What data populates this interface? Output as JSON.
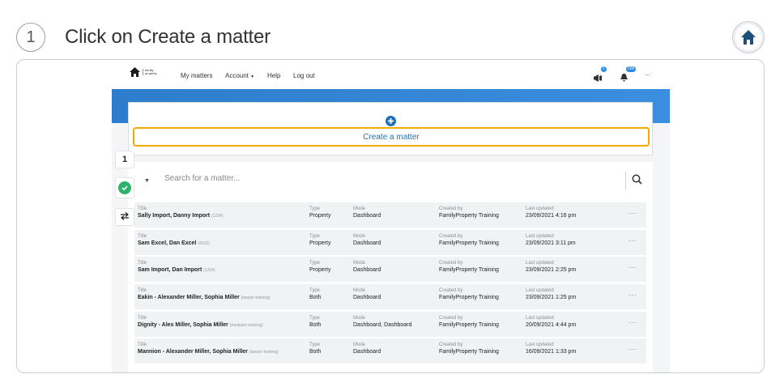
{
  "step": {
    "number": "1",
    "title": "Click on Create a matter"
  },
  "app": {
    "logo_text": "family property",
    "nav": {
      "my_matters": "My matters",
      "account": "Account",
      "help": "Help",
      "logout": "Log out"
    },
    "badges": {
      "notifications": "2",
      "alerts": "200"
    },
    "more_label": "...",
    "create_button": "Create a matter",
    "search_placeholder": "Search for a matter...",
    "columns": {
      "title": "Title",
      "type": "Type",
      "mode": "Mode",
      "created_by": "Created by",
      "last_updated": "Last updated"
    },
    "rows": [
      {
        "title": "Sally Import, Danny Import",
        "code": "(1234)",
        "type": "Property",
        "mode": "Dashboard",
        "created_by": "FamilyProperty Training",
        "updated": "23/09/2021 4:16 pm"
      },
      {
        "title": "Sam Excel, Dan Excel",
        "code": "(4322)",
        "type": "Property",
        "mode": "Dashboard",
        "created_by": "FamilyProperty Training",
        "updated": "23/09/2021 3:11 pm"
      },
      {
        "title": "Sam Import, Dan Import",
        "code": "(1234)",
        "type": "Property",
        "mode": "Dashboard",
        "created_by": "FamilyProperty Training",
        "updated": "23/09/2021 2:25 pm"
      },
      {
        "title": "Eakin - Alexander Miller, Sophia Miller",
        "code": "(lawyer-training)",
        "type": "Both",
        "mode": "Dashboard",
        "created_by": "FamilyProperty Training",
        "updated": "23/09/2021 1:25 pm"
      },
      {
        "title": "Dignity - Alex Miller, Sophia Miller",
        "code": "(mediator-training)",
        "type": "Both",
        "mode": "Dashboard, Dashboard",
        "created_by": "FamilyProperty Training",
        "updated": "20/09/2021 4:44 pm"
      },
      {
        "title": "Mannion - Alexander Miller, Sophia Miller",
        "code": "(lawyer-training)",
        "type": "Both",
        "mode": "Dashboard",
        "created_by": "FamilyProperty Training",
        "updated": "16/09/2021 1:33 pm"
      }
    ]
  },
  "side_widget": {
    "step_count": "1"
  },
  "colors": {
    "brand_blue": "#2d7dcc",
    "highlight": "#f2a900",
    "success": "#2db36a"
  }
}
